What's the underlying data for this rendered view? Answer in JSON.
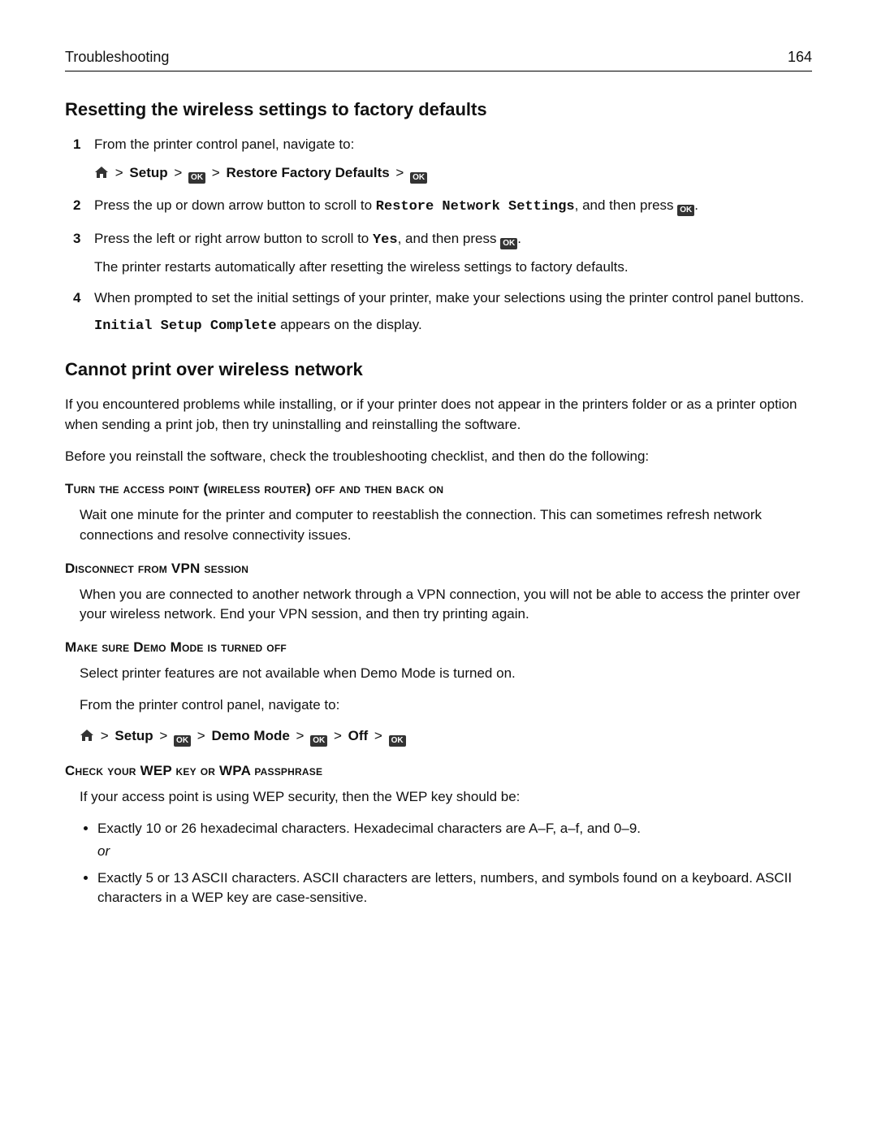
{
  "header": {
    "section": "Troubleshooting",
    "page": "164"
  },
  "sec1": {
    "title": "Resetting the wireless settings to factory defaults",
    "step1": {
      "text": "From the printer control panel, navigate to:",
      "nav": {
        "setup": "Setup",
        "restore": "Restore Factory Defaults"
      }
    },
    "step2": {
      "a": "Press the up or down arrow button to scroll to ",
      "code": "Restore Network Settings",
      "b": ", and then press ",
      "c": "."
    },
    "step3": {
      "a": "Press the left or right arrow button to scroll to ",
      "code": "Yes",
      "b": ", and then press ",
      "c": ".",
      "extra": "The printer restarts automatically after resetting the wireless settings to factory defaults."
    },
    "step4": {
      "text": "When prompted to set the initial settings of your printer, make your selections using the printer control panel buttons.",
      "code": "Initial Setup Complete",
      "after": " appears on the display."
    }
  },
  "sec2": {
    "title": "Cannot print over wireless network",
    "p1": "If you encountered problems while installing, or if your printer does not appear in the printers folder or as a printer option when sending a print job, then try uninstalling and reinstalling the software.",
    "p2": "Before you reinstall the software, check the troubleshooting checklist, and then do the following:",
    "sub1": {
      "title": "Turn the access point (wireless router) off and then back on",
      "body": "Wait one minute for the printer and computer to reestablish the connection. This can sometimes refresh network connections and resolve connectivity issues."
    },
    "sub2": {
      "title": "Disconnect from VPN session",
      "body": "When you are connected to another network through a VPN connection, you will not be able to access the printer over your wireless network. End your VPN session, and then try printing again."
    },
    "sub3": {
      "title": "Make sure Demo Mode is turned off",
      "body": "Select printer features are not available when Demo Mode is turned on.",
      "body2": "From the printer control panel, navigate to:",
      "nav": {
        "setup": "Setup",
        "demo": "Demo Mode",
        "off": "Off"
      }
    },
    "sub4": {
      "title": "Check your WEP key or WPA passphrase",
      "body": "If your access point is using WEP security, then the WEP key should be:",
      "li1": "Exactly 10 or 26 hexadecimal characters. Hexadecimal characters are A–F, a–f, and 0–9.",
      "or": "or",
      "li2": "Exactly 5 or 13 ASCII characters. ASCII characters are letters, numbers, and symbols found on a keyboard. ASCII characters in a WEP key are case‑sensitive."
    }
  },
  "glyph": {
    "gt": ">"
  }
}
